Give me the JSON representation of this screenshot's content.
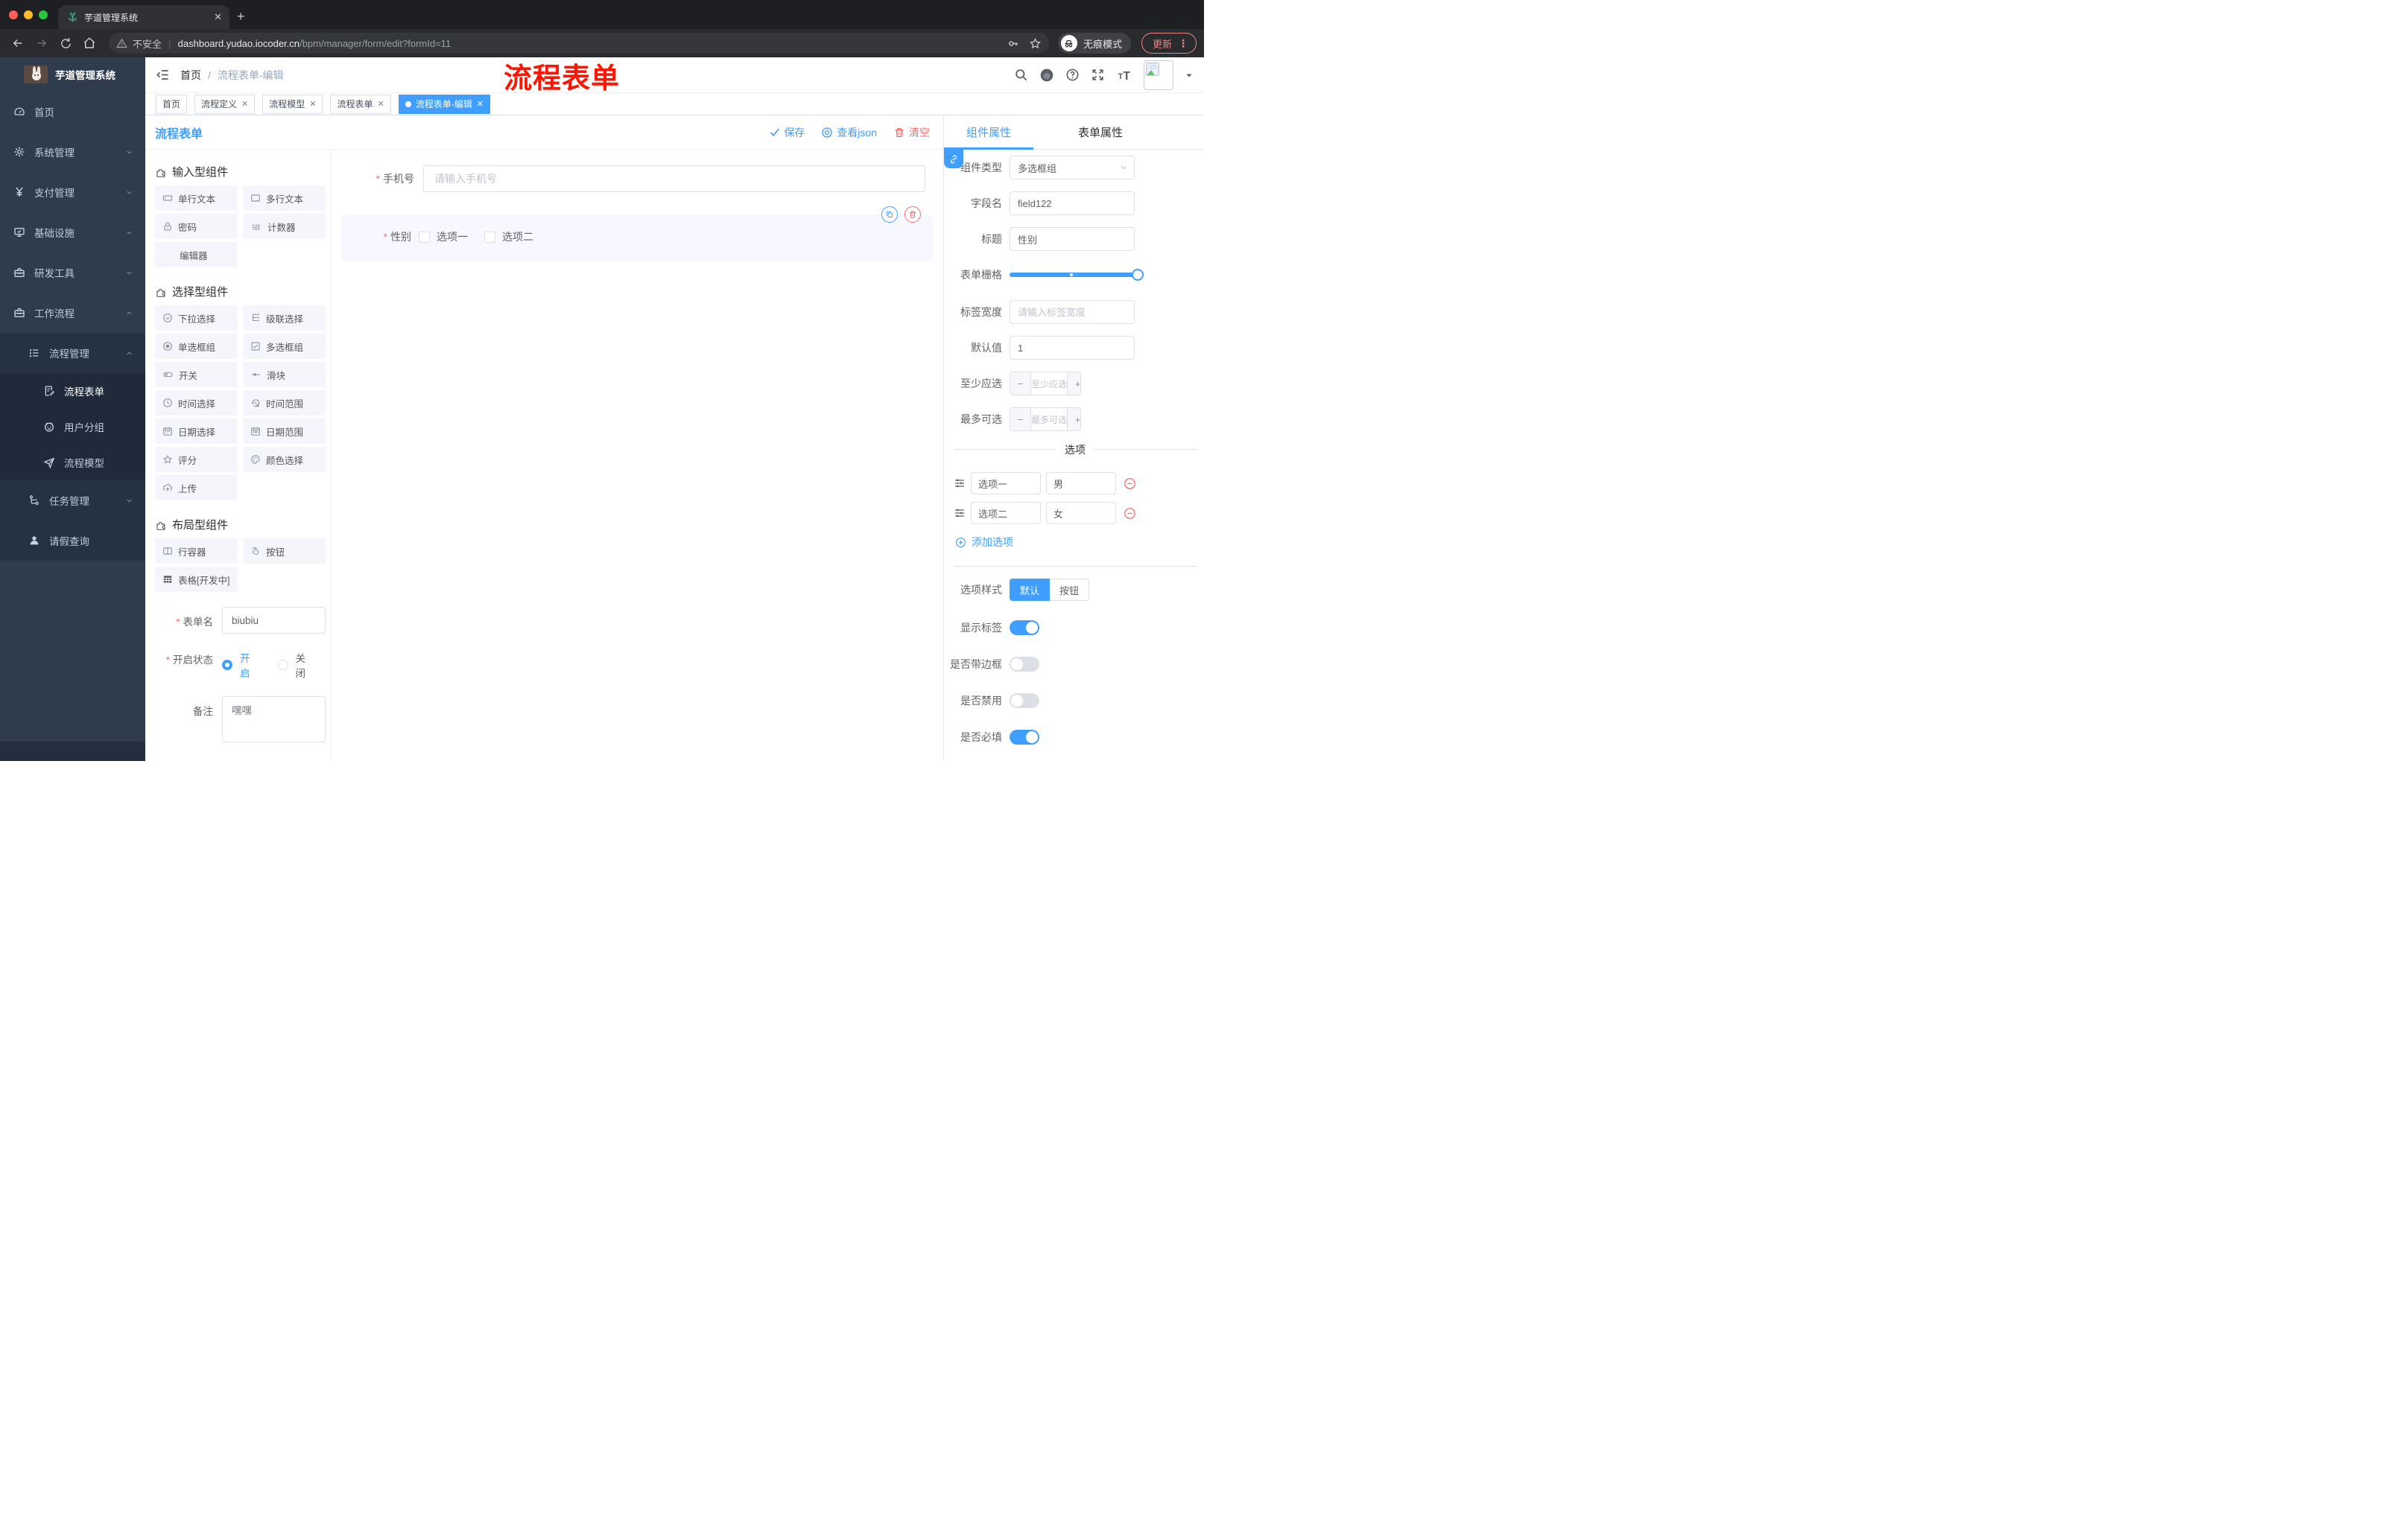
{
  "colors": {
    "accent": "#409EFF",
    "danger": "#F56C6C",
    "annotation_red": "#FE1400",
    "sidebar_bg": "#2E3C4E",
    "active_tag_bg": "#409EFF"
  },
  "browser": {
    "tab_title": "芋道管理系统",
    "security_label": "不安全",
    "url_domain": "dashboard.yudao.iocoder.cn",
    "url_path": "/bpm/manager/form/edit?formId=11",
    "incognito_label": "无痕模式",
    "update_label": "更新"
  },
  "sidebar": {
    "logo_title": "芋道管理系统",
    "items": [
      {
        "label": "首页",
        "icon": "dashboard-icon",
        "expandable": false
      },
      {
        "label": "系统管理",
        "icon": "gear-icon",
        "expandable": true
      },
      {
        "label": "支付管理",
        "icon": "yen-icon",
        "expandable": true
      },
      {
        "label": "基础设施",
        "icon": "monitor-icon",
        "expandable": true
      },
      {
        "label": "研发工具",
        "icon": "toolbox-icon",
        "expandable": true
      },
      {
        "label": "工作流程",
        "icon": "briefcase-icon",
        "expandable": true,
        "expanded": true
      }
    ],
    "submenu": [
      {
        "label": "流程管理",
        "icon": "tree-list-icon",
        "level": 1,
        "expanded": true
      },
      {
        "label": "流程表单",
        "icon": "document-edit-icon",
        "level": 2,
        "active": true
      },
      {
        "label": "用户分组",
        "icon": "robot-icon",
        "level": 2
      },
      {
        "label": "流程模型",
        "icon": "paper-plane-icon",
        "level": 2
      },
      {
        "label": "任务管理",
        "icon": "flow-icon",
        "level": 1,
        "expandable": true
      },
      {
        "label": "请假查询",
        "icon": "person-icon",
        "level": 1
      }
    ]
  },
  "header": {
    "breadcrumb": {
      "root": "首页",
      "sep": "/",
      "current": "流程表单-编辑"
    },
    "annotation": "流程表单"
  },
  "tags": [
    {
      "label": "首页",
      "closable": false,
      "active": false
    },
    {
      "label": "流程定义",
      "closable": true,
      "active": false
    },
    {
      "label": "流程模型",
      "closable": true,
      "active": false
    },
    {
      "label": "流程表单",
      "closable": true,
      "active": false
    },
    {
      "label": "流程表单-编辑",
      "closable": true,
      "active": true
    }
  ],
  "toolbar": {
    "title": "流程表单",
    "save_label": "保存",
    "view_json_label": "查看json",
    "clear_label": "清空"
  },
  "palette": {
    "sections": [
      {
        "title": "输入型组件",
        "items": [
          {
            "label": "单行文本",
            "icon": "text-field-icon"
          },
          {
            "label": "多行文本",
            "icon": "textarea-icon"
          },
          {
            "label": "密码",
            "icon": "lock-icon"
          },
          {
            "label": "计数器",
            "icon": "number-123-icon"
          },
          {
            "label": "编辑器",
            "icon": ""
          }
        ]
      },
      {
        "title": "选择型组件",
        "items": [
          {
            "label": "下拉选择",
            "icon": "select-icon"
          },
          {
            "label": "级联选择",
            "icon": "cascader-icon"
          },
          {
            "label": "单选框组",
            "icon": "radio-icon"
          },
          {
            "label": "多选框组",
            "icon": "checkbox-icon"
          },
          {
            "label": "开关",
            "icon": "switch-icon"
          },
          {
            "label": "滑块",
            "icon": "slider-icon"
          },
          {
            "label": "时间选择",
            "icon": "clock-icon"
          },
          {
            "label": "时间范围",
            "icon": "time-range-icon"
          },
          {
            "label": "日期选择",
            "icon": "calendar-icon"
          },
          {
            "label": "日期范围",
            "icon": "calendar-range-icon"
          },
          {
            "label": "评分",
            "icon": "star-icon"
          },
          {
            "label": "颜色选择",
            "icon": "palette-icon"
          },
          {
            "label": "上传",
            "icon": "upload-icon"
          }
        ]
      },
      {
        "title": "布局型组件",
        "items": [
          {
            "label": "行容器",
            "icon": "row-container-icon"
          },
          {
            "label": "按钮",
            "icon": "button-click-icon"
          },
          {
            "label": "表格[开发中]",
            "icon": "table-icon"
          }
        ]
      }
    ]
  },
  "meta_form": {
    "name_label": "表单名",
    "name_value": "biubiu",
    "status_label": "开启状态",
    "status_on": "开启",
    "status_off": "关闭",
    "status_selected": "开启",
    "remark_label": "备注",
    "remark_value": "嘿嘿"
  },
  "canvas": {
    "phone": {
      "label": "手机号",
      "placeholder": "请输入手机号",
      "required": true
    },
    "gender": {
      "label": "性别",
      "required": true,
      "options": [
        "选项一",
        "选项二"
      ]
    }
  },
  "panel": {
    "tabs": {
      "component": "组件属性",
      "form": "表单属性"
    },
    "component_type": {
      "label": "组件类型",
      "value": "多选框组"
    },
    "field_name": {
      "label": "字段名",
      "value": "field122"
    },
    "title": {
      "label": "标题",
      "value": "性别"
    },
    "grid": {
      "label": "表单栅格"
    },
    "label_width": {
      "label": "标签宽度",
      "placeholder": "请输入标签宽度"
    },
    "default_value": {
      "label": "默认值",
      "value": "1"
    },
    "min_select": {
      "label": "至少应选",
      "placeholder": "至少应选"
    },
    "max_select": {
      "label": "最多可选",
      "placeholder": "最多可选"
    },
    "options_divider": "选项",
    "options": [
      {
        "label": "选项一",
        "value": "男"
      },
      {
        "label": "选项二",
        "value": "女"
      }
    ],
    "add_option_label": "添加选项",
    "option_style": {
      "label": "选项样式",
      "choices": [
        "默认",
        "按钮"
      ],
      "selected": "默认"
    },
    "switches": [
      {
        "label": "显示标签",
        "on": true
      },
      {
        "label": "是否带边框",
        "on": false
      },
      {
        "label": "是否禁用",
        "on": false
      },
      {
        "label": "是否必填",
        "on": true
      }
    ]
  }
}
